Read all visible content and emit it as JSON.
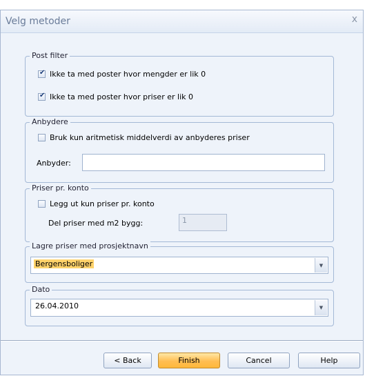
{
  "window": {
    "title": "Velg metoder",
    "close_glyph": "x"
  },
  "post_filter": {
    "legend": "Post filter",
    "options": [
      {
        "label": "Ikke ta med poster hvor mengder er lik 0",
        "checked": true
      },
      {
        "label": "Ikke ta med poster hvor priser er lik 0",
        "checked": true
      }
    ]
  },
  "anbydere": {
    "legend": "Anbydere",
    "option": {
      "label": "Bruk kun aritmetisk middelverdi av anbyderes priser",
      "checked": false
    },
    "field_label": "Anbyder:",
    "field_value": ""
  },
  "priser": {
    "legend": "Priser pr. konto",
    "option": {
      "label": "Legg ut kun priser pr. konto",
      "checked": false
    },
    "field_label": "Del priser med m2 bygg:",
    "field_value": "1"
  },
  "lagre": {
    "legend": "Lagre priser med prosjektnavn",
    "selected": "Bergensboliger"
  },
  "dato": {
    "legend": "Dato",
    "selected": "26.04.2010"
  },
  "buttons": {
    "back": "< Back",
    "finish": "Finish",
    "cancel": "Cancel",
    "help": "Help"
  },
  "icons": {
    "checkmark": "✔",
    "dropdown": "▼"
  }
}
